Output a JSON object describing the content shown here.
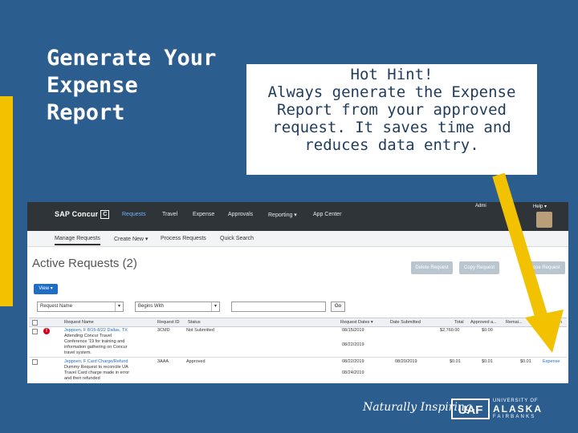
{
  "slide": {
    "title_lines": [
      "Generate Your",
      "Expense",
      "Report"
    ],
    "hint_lines": [
      "Hot Hint!",
      "Always generate the Expense",
      "Report from your approved",
      "request. It saves time and",
      "reduces data entry."
    ],
    "colors": {
      "background": "#2c5d8f",
      "accent": "#f2c200",
      "arrow": "#f2c200"
    }
  },
  "sap": {
    "brand": "SAP Concur",
    "brand_mark": "C",
    "nav": [
      "Requests",
      "Travel",
      "Expense",
      "Approvals",
      "Reporting ▾",
      "App Center"
    ],
    "admin": "Admi",
    "help": "Help ▾",
    "subnav": [
      "Manage Requests",
      "Create New ▾",
      "Process Requests",
      "Quick Search"
    ],
    "page_title": "Active Requests (2)",
    "buttons": [
      "Delete Request",
      "Copy Request",
      "Close Request"
    ],
    "view_btn": "View ▾",
    "filter1": "Request Name",
    "filter2": "Begins With",
    "go": "Go",
    "columns": [
      "Request Name",
      "Request ID",
      "Status",
      "Request Dates ▾",
      "Date Submitted",
      "Total",
      "Approved a...",
      "Remai...",
      "...ion"
    ],
    "rows": [
      {
        "name_lines": [
          "Jeppsen, F 8/15-8/22 Dallas, TX",
          "Attending Concur Travel",
          "Conference '19 for training and",
          "information gathering on Concur",
          "travel system."
        ],
        "id": "3CMD",
        "status": "Not Submitted",
        "dates": [
          "08/15/2019",
          "08/22/2019"
        ],
        "submitted": "",
        "total": "$2,760.00",
        "approved": "$0.00",
        "remaining": "",
        "action": ""
      },
      {
        "name_lines": [
          "Jeppsen, F Card Charge/Refund",
          "Dummy Request to reconcile UA",
          "Travel Card charge made in error",
          "and then refunded"
        ],
        "id": "3AAA",
        "status": "Approved",
        "dates": [
          "08/22/2019",
          "08/24/2019"
        ],
        "submitted": "08/20/2019",
        "total": "$0.01",
        "approved": "$0.01",
        "remaining": "$0.01",
        "action": "Expense"
      }
    ]
  },
  "footer": {
    "tagline": "Naturally Inspiring.",
    "logo_mark": "UAF",
    "uaf_line1": "UNIVERSITY OF",
    "uaf_line2": "ALASKA",
    "uaf_line3": "FAIRBANKS"
  }
}
